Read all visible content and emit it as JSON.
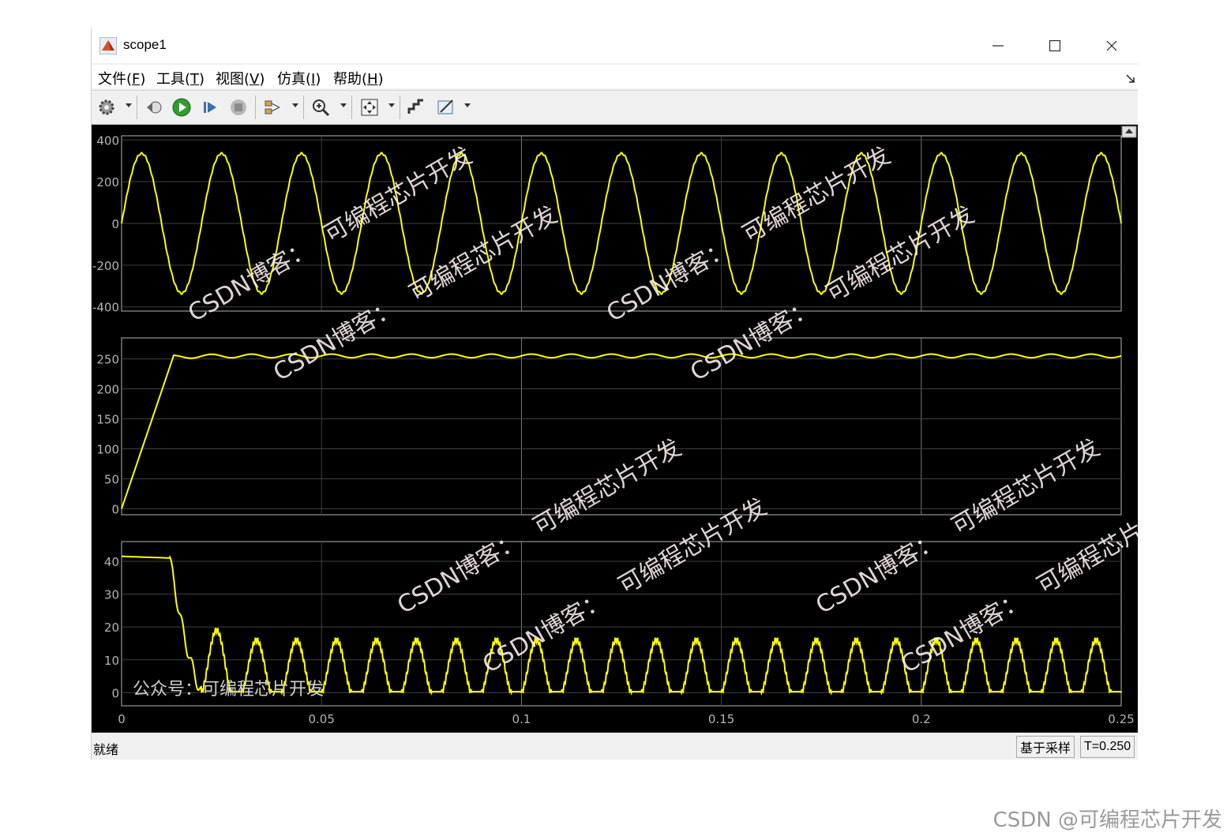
{
  "window": {
    "title": "scope1"
  },
  "menu": [
    {
      "label": "文件(",
      "key": "F",
      "close": ")"
    },
    {
      "label": "工具(",
      "key": "T",
      "close": ")"
    },
    {
      "label": "视图(",
      "key": "V",
      "close": ")"
    },
    {
      "label": "仿真(",
      "key": "I",
      "close": ")"
    },
    {
      "label": "帮助(",
      "key": "H",
      "close": ")"
    }
  ],
  "toolbar_icons": [
    "gear-icon",
    "step-back-icon",
    "run-icon",
    "step-forward-icon",
    "stop-icon",
    "highlight-icon",
    "zoom-icon",
    "fit-icon",
    "scale-icon",
    "style-icon"
  ],
  "chart_data": [
    {
      "type": "line",
      "yticks": [
        400,
        200,
        0,
        -200,
        -400
      ],
      "ylim": [
        -420,
        420
      ],
      "xlim": [
        0,
        0.25
      ],
      "grid": true,
      "series": [
        {
          "color": "#ffff00",
          "kind": "sine",
          "amplitude": 335,
          "frequency_hz": 50
        }
      ]
    },
    {
      "type": "line",
      "yticks": [
        250,
        200,
        150,
        100,
        50,
        0
      ],
      "ylim": [
        -10,
        285
      ],
      "xlim": [
        0,
        0.25
      ],
      "grid": true,
      "series": [
        {
          "color": "#ffff00",
          "kind": "ramp",
          "start": 0,
          "steady": 255,
          "settle_time": 0.013,
          "ripple": 3
        }
      ]
    },
    {
      "type": "line",
      "yticks": [
        40,
        30,
        20,
        10,
        0
      ],
      "ylim": [
        -4,
        46
      ],
      "xlim": [
        0,
        0.25
      ],
      "xticks": [
        "0",
        "0.05",
        "0.1",
        "0.15",
        "0.2",
        "0.25"
      ],
      "grid": true,
      "series": [
        {
          "color": "#ffff00",
          "kind": "pulses",
          "initial": 41.5,
          "drop_time": 0.012,
          "period": 0.01,
          "peak": 16,
          "first_peak": 19
        }
      ]
    }
  ],
  "watermarks": {
    "line1": "CSDN博客：",
    "line2": "可编程芯片开发",
    "wechat": "公众号：可编程芯片开发"
  },
  "status": {
    "left": "就绪",
    "mode": "基于采样",
    "time": "T=0.250"
  },
  "footer": "CSDN @可编程芯片开发",
  "colors": {
    "plot_bg": "#000000",
    "trace": "#ffff00",
    "axis": "#b4b4b4",
    "grid": "#404040"
  }
}
